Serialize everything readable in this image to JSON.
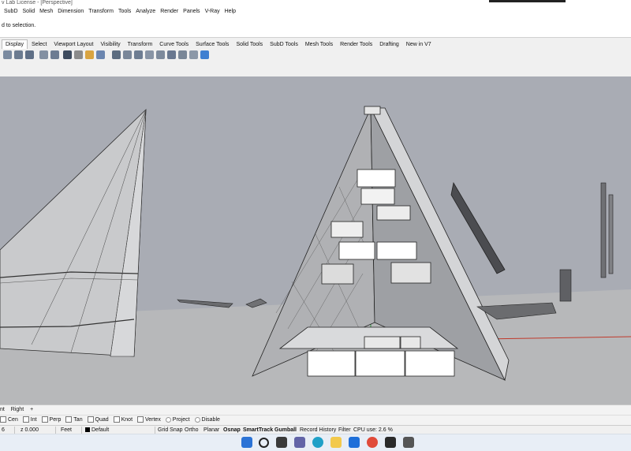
{
  "window": {
    "title": "v Lab License - [Perspective]"
  },
  "menu": [
    "SubD",
    "Solid",
    "Mesh",
    "Dimension",
    "Transform",
    "Tools",
    "Analyze",
    "Render",
    "Panels",
    "V-Ray",
    "Help"
  ],
  "command_line": {
    "text": "d to selection."
  },
  "toolbar_tabs": [
    "Display",
    "Select",
    "Viewport Layout",
    "Visibility",
    "Transform",
    "Curve Tools",
    "Surface Tools",
    "Solid Tools",
    "SubD Tools",
    "Mesh Tools",
    "Render Tools",
    "Drafting",
    "New in V7"
  ],
  "active_tab": "Display",
  "viewport": {
    "name": "Perspective"
  },
  "view_tabs": {
    "items": [
      "nt",
      "Right"
    ],
    "add": "+"
  },
  "osnaps": [
    {
      "label": "Cen",
      "checked": false
    },
    {
      "label": "Int",
      "checked": false
    },
    {
      "label": "Perp",
      "checked": false
    },
    {
      "label": "Tan",
      "checked": false
    },
    {
      "label": "Quad",
      "checked": false
    },
    {
      "label": "Knot",
      "checked": false
    },
    {
      "label": "Vertex",
      "checked": false
    }
  ],
  "osnap_extra": {
    "project": "Project",
    "disable": "Disable"
  },
  "status": {
    "coord": "6",
    "z": "z 0.000",
    "units": "Feet",
    "layer": "Default",
    "grid_snap": "Grid Snap",
    "ortho": "Ortho",
    "planar": "Planar",
    "osnap": "Osnap",
    "smarttrack": "SmartTrack",
    "gumball": "Gumball",
    "record_history": "Record History",
    "filter": "Filter",
    "cpu": "CPU use: 2.6 %"
  },
  "colors": {
    "viewport_bg": "#a9acb4",
    "ground": "#b8b9bb",
    "red_axis": "#c0392b",
    "green_axis": "#2e8b3a"
  },
  "taskbar_icons": [
    "windows-start-icon",
    "search-icon",
    "task-view-icon",
    "chat-icon",
    "edge-icon",
    "file-explorer-icon",
    "store-icon",
    "chrome-icon",
    "rhino-icon",
    "cursor-app-icon"
  ]
}
